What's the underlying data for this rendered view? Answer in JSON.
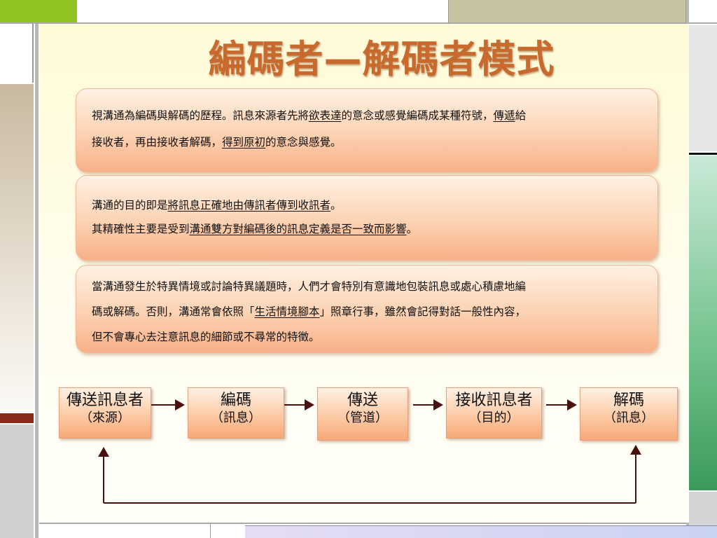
{
  "title": "編碼者—解碼者模式",
  "panels": [
    {
      "line1_pre": "視溝通為編碼與解碼的歷程。訊息來源者先將",
      "line1_u1": "欲表達",
      "line1_mid": "的意念或感覺編碼成某種符號，",
      "line1_u2": "傳遞",
      "line1_post": "給",
      "line2_pre": "接收者，再由接收者解碼，",
      "line2_u": "得到原初",
      "line2_post": "的意念與感覺。"
    },
    {
      "line1_pre": "溝通的目的即是",
      "line1_u": "將訊息正確地由傳訊者傳到收訊者",
      "line1_post": "。",
      "line2_pre": "其精確性主要是受到",
      "line2_u": "溝通雙方對編碼後的訊息定義是否一致而影響",
      "line2_post": "。"
    },
    {
      "line1": "當溝通發生於特異情境或討論特異議題時，人們才會特別有意識地包裝訊息或處心積慮地編",
      "line2_pre": "碼或解碼。否則，溝通常會依照「",
      "line2_u": "生活情境腳本",
      "line2_post": "」照章行事，雖然會記得對話一般性內容，",
      "line3": "但不會專心去注意訊息的細節或不尋常的特徵。"
    }
  ],
  "flow": [
    {
      "main": "傳送訊息者",
      "sub": "（來源）"
    },
    {
      "main": "編碼",
      "sub": "（訊息）"
    },
    {
      "main": "傳送",
      "sub": "（管道）"
    },
    {
      "main": "接收訊息者",
      "sub": "（目的）"
    },
    {
      "main": "解碼",
      "sub": "（訊息）"
    }
  ],
  "colors": {
    "title": "#c86a2e",
    "panel_fill": "#fcd2b2",
    "arrow": "#4a1010",
    "accent_green": "#8fc31f",
    "accent_dark_green": "#3b9a5c"
  }
}
